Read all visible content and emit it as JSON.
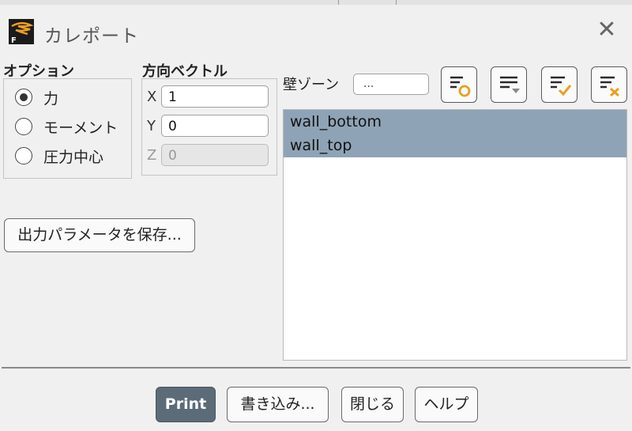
{
  "window": {
    "title": "カレポート"
  },
  "options": {
    "label": "オプション",
    "items": [
      {
        "label": "力",
        "selected": true
      },
      {
        "label": "モーメント",
        "selected": false
      },
      {
        "label": "圧力中心",
        "selected": false
      }
    ]
  },
  "direction": {
    "label": "方向ベクトル",
    "x": {
      "axis": "X",
      "value": "1"
    },
    "y": {
      "axis": "Y",
      "value": "0"
    },
    "z": {
      "axis": "Z",
      "value": "0"
    }
  },
  "save_button": "出力パラメータを保存...",
  "wall_zones": {
    "label": "壁ゾーン",
    "filter_value": "...",
    "items": [
      "wall_bottom",
      "wall_top"
    ]
  },
  "footer": {
    "print": "Print",
    "write": "書き込み...",
    "close": "閉じる",
    "help": "ヘルプ"
  },
  "colors": {
    "selection": "#8fa3b6",
    "primary_button": "#5c6b78",
    "accent_orange": "#e8a020"
  }
}
